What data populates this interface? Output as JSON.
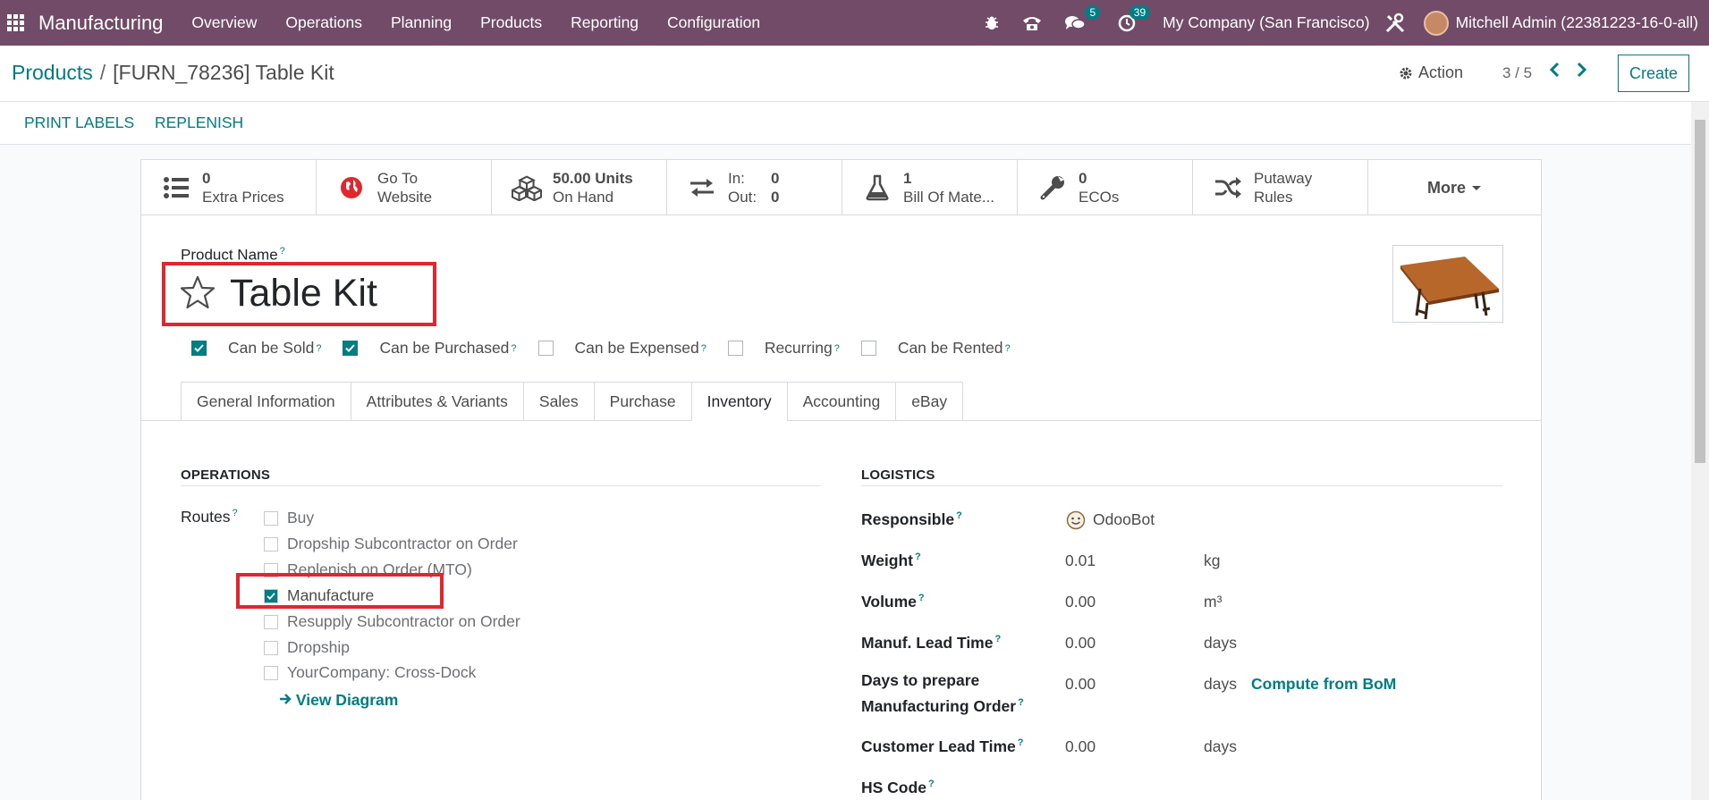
{
  "navbar": {
    "app_name": "Manufacturing",
    "menu": [
      "Overview",
      "Operations",
      "Planning",
      "Products",
      "Reporting",
      "Configuration"
    ],
    "messages_count": "5",
    "activities_count": "39",
    "company": "My Company (San Francisco)",
    "user": "Mitchell Admin (22381223-16-0-all)"
  },
  "control": {
    "breadcrumb_parent": "Products",
    "breadcrumb_separator": "/",
    "breadcrumb_current": "[FURN_78236] Table Kit",
    "action_label": "Action",
    "pager": "3 / 5",
    "create_label": "Create"
  },
  "statusbar": {
    "print_labels": "PRINT LABELS",
    "replenish": "REPLENISH"
  },
  "smart_buttons": [
    {
      "value": "0",
      "label": "Extra Prices",
      "icon": "list-icon"
    },
    {
      "value": "Go To",
      "label": "Website",
      "icon": "globe-icon"
    },
    {
      "value": "50.00 Units",
      "label": "On Hand",
      "icon": "cubes-icon"
    },
    {
      "value": "In:",
      "value2": "0",
      "label": "Out:",
      "label2": "0",
      "icon": "exchange-icon"
    },
    {
      "value": "1",
      "label": "Bill Of Mate...",
      "icon": "flask-icon"
    },
    {
      "value": "0",
      "label": "ECOs",
      "icon": "wrench-icon"
    },
    {
      "value": "Putaway",
      "label": "Rules",
      "icon": "random-icon"
    }
  ],
  "more_label": "More",
  "product": {
    "name_label": "Product Name",
    "name": "Table Kit",
    "help_mark": "?"
  },
  "flags": [
    {
      "label": "Can be Sold",
      "checked": true
    },
    {
      "label": "Can be Purchased",
      "checked": true
    },
    {
      "label": "Can be Expensed",
      "checked": false
    },
    {
      "label": "Recurring",
      "checked": false
    },
    {
      "label": "Can be Rented",
      "checked": false
    }
  ],
  "tabs": [
    "General Information",
    "Attributes & Variants",
    "Sales",
    "Purchase",
    "Inventory",
    "Accounting",
    "eBay"
  ],
  "active_tab": "Inventory",
  "operations": {
    "heading": "OPERATIONS",
    "routes_label": "Routes",
    "routes": [
      {
        "label": "Buy",
        "checked": false
      },
      {
        "label": "Dropship Subcontractor on Order",
        "checked": false
      },
      {
        "label": "Replenish on Order (MTO)",
        "checked": false
      },
      {
        "label": "Manufacture",
        "checked": true
      },
      {
        "label": "Resupply Subcontractor on Order",
        "checked": false
      },
      {
        "label": "Dropship",
        "checked": false
      },
      {
        "label": "YourCompany: Cross-Dock",
        "checked": false
      }
    ],
    "view_diagram": "View Diagram"
  },
  "logistics": {
    "heading": "LOGISTICS",
    "responsible_label": "Responsible",
    "responsible_value": "OdooBot",
    "weight_label": "Weight",
    "weight_value": "0.01",
    "weight_unit": "kg",
    "volume_label": "Volume",
    "volume_value": "0.00",
    "volume_unit": "m³",
    "manuf_lead_label": "Manuf. Lead Time",
    "manuf_lead_value": "0.00",
    "manuf_lead_unit": "days",
    "days_prepare_label_1": "Days to prepare",
    "days_prepare_label_2": "Manufacturing Order",
    "days_prepare_value": "0.00",
    "days_prepare_unit": "days",
    "compute_from_bom": "Compute from BoM",
    "customer_lead_label": "Customer Lead Time",
    "customer_lead_value": "0.00",
    "customer_lead_unit": "days",
    "hs_code_label": "HS Code"
  },
  "colors": {
    "navbar": "#714b67",
    "accent": "#017e84",
    "highlight": "#e1262d"
  }
}
